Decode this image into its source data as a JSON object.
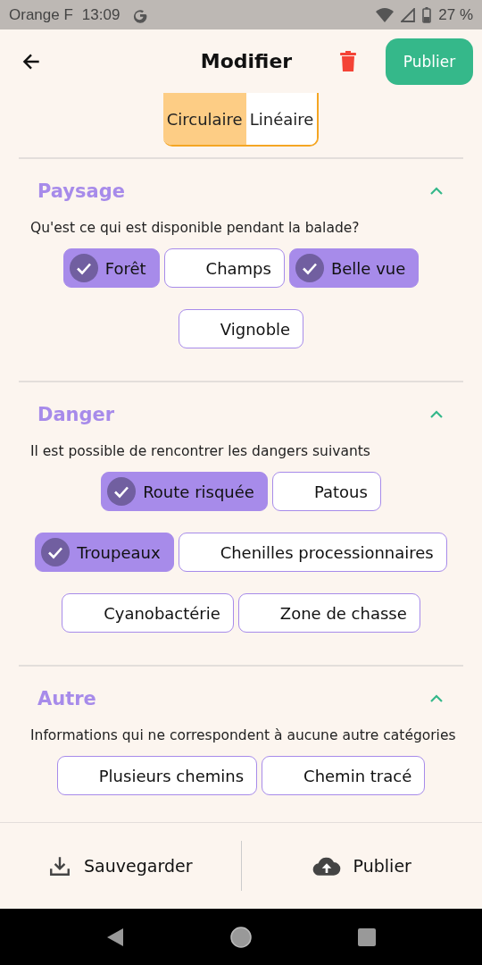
{
  "status_bar": {
    "carrier": "Orange F",
    "time": "13:09",
    "battery": "27 %"
  },
  "header": {
    "title": "Modifier",
    "publish_button": "Publier"
  },
  "route_type": [
    {
      "label": "Circulaire",
      "selected": true
    },
    {
      "label": "Linéaire",
      "selected": false
    }
  ],
  "sections": [
    {
      "title": "Paysage",
      "expanded": true,
      "description": "Qu'est ce qui est disponible pendant la balade?",
      "lines": [
        {
          "chips": [
            {
              "label": "Forêt",
              "checked": true
            },
            {
              "label": "Champs",
              "checked": false
            },
            {
              "label": "Belle vue",
              "checked": true
            }
          ]
        },
        {
          "chips": [
            {
              "label": "Vignoble",
              "checked": false
            }
          ]
        }
      ]
    },
    {
      "title": "Danger",
      "expanded": true,
      "description": "Il est possible de rencontrer les dangers suivants",
      "lines": [
        {
          "chips": [
            {
              "label": "Route risquée",
              "checked": true
            },
            {
              "label": "Patous",
              "checked": false
            }
          ]
        },
        {
          "chips": [
            {
              "label": "Troupeaux",
              "checked": true
            },
            {
              "label": "Chenilles processionnaires",
              "checked": false
            }
          ]
        },
        {
          "chips": [
            {
              "label": "Cyanobactérie",
              "checked": false
            },
            {
              "label": "Zone de chasse",
              "checked": false
            }
          ]
        }
      ]
    },
    {
      "title": "Autre",
      "expanded": true,
      "description": "Informations qui ne correspondent à aucune autre catégories",
      "lines": [
        {
          "chips": [
            {
              "label": "Plusieurs chemins",
              "checked": false
            },
            {
              "label": "Chemin tracé",
              "checked": false
            }
          ]
        }
      ]
    }
  ],
  "bottom_bar": {
    "save": "Sauvegarder",
    "publish": "Publier"
  }
}
